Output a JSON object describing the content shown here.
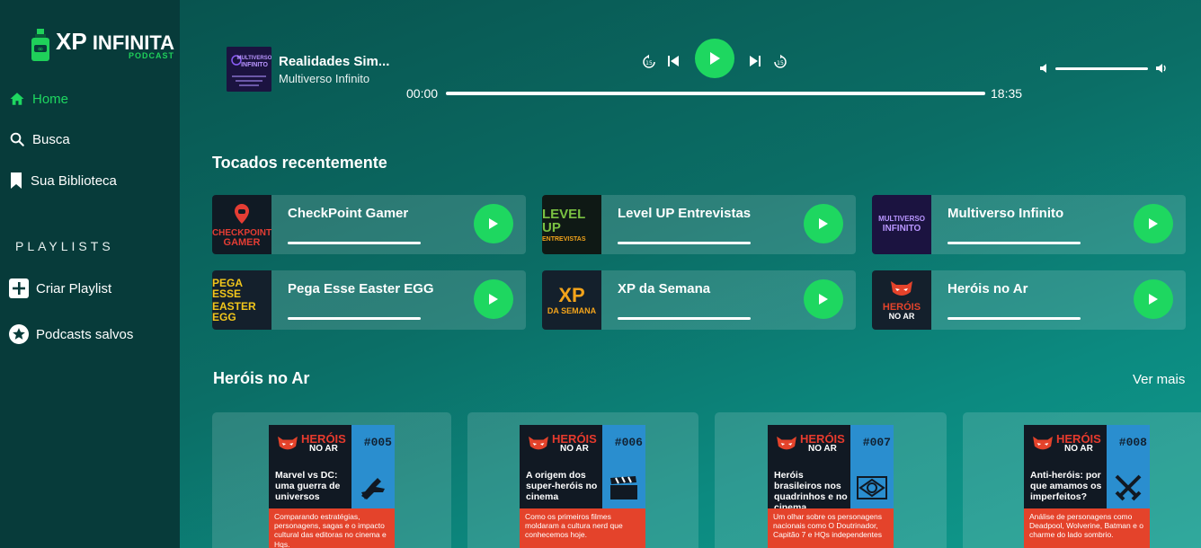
{
  "logo": {
    "xp": "XP",
    "name": "INFINITA",
    "sub": "PODCAST"
  },
  "sidebar": {
    "nav": [
      {
        "label": "Home",
        "icon": "home-icon",
        "active": true
      },
      {
        "label": "Busca",
        "icon": "search-icon"
      },
      {
        "label": "Sua Biblioteca",
        "icon": "bookmark-icon"
      }
    ],
    "playlists_heading": "PLAYLISTS",
    "playlist_items": [
      {
        "label": "Criar Playlist",
        "icon": "plus-square-icon"
      },
      {
        "label": "Podcasts salvos",
        "icon": "star-circle-icon"
      }
    ]
  },
  "player": {
    "title": "Realidades Sim...",
    "artist": "Multiverso Infinito",
    "cover_text": "MULTIVERSO INFINITO",
    "current_time": "00:00",
    "duration": "18:35",
    "progress": 0,
    "volume": 1.0
  },
  "recent": {
    "heading": "Tocados recentemente",
    "items": [
      {
        "name": "CheckPoint Gamer",
        "thumb_top": "CHECKPOINT",
        "thumb_bottom": "GAMER"
      },
      {
        "name": "Level UP Entrevistas",
        "thumb_top": "LEVEL UP",
        "thumb_bottom": "ENTREVISTAS"
      },
      {
        "name": "Multiverso Infinito",
        "thumb_top": "MULTIVERSO",
        "thumb_bottom": "INFINITO"
      },
      {
        "name": "Pega Esse Easter EGG",
        "thumb_top": "PEGA ESSE",
        "thumb_bottom": "EASTER EGG"
      },
      {
        "name": "XP da Semana",
        "thumb_top": "XP",
        "thumb_bottom": "DA SEMANA"
      },
      {
        "name": "Heróis no Ar",
        "thumb_top": "HERÓIS",
        "thumb_bottom": "NO AR"
      }
    ]
  },
  "herois": {
    "heading": "Heróis no Ar",
    "see_more": "Ver mais",
    "brand_a": "HERÓIS",
    "brand_b": "NO AR",
    "episodes": [
      {
        "num": "#005",
        "title": "Marvel vs DC: uma guerra de universos",
        "desc": "Comparando estratégias, personagens, sagas e o impacto cultural das editoras no cinema e Hqs.",
        "icon": "flying-hero-icon"
      },
      {
        "num": "#006",
        "title": "A origem dos super-heróis no cinema",
        "desc": "Como os primeiros filmes moldaram a cultura nerd que conhecemos hoje.",
        "icon": "clapperboard-icon"
      },
      {
        "num": "#007",
        "title": "Heróis brasileiros nos quadrinhos e no cinema",
        "desc": "Um olhar sobre os personagens nacionais como O Doutrinador, Capitão 7 e HQs independentes",
        "icon": "brazil-flag-icon"
      },
      {
        "num": "#008",
        "title": "Anti-heróis: por que amamos os imperfeitos?",
        "desc": "Análise de personagens como Deadpool, Wolverine, Batman e o charme do lado sombrio.",
        "icon": "crossed-swords-icon"
      }
    ]
  },
  "colors": {
    "accent": "#1ed760",
    "sidebar": "#073b3a",
    "episode_red": "#e4432b",
    "episode_blue": "#2a8ecf"
  }
}
